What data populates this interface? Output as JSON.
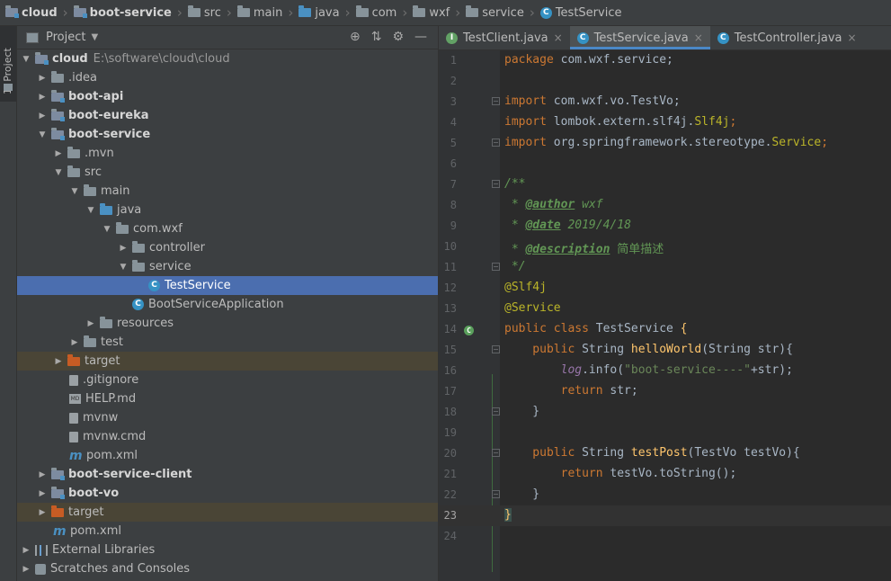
{
  "breadcrumb": [
    "cloud",
    "boot-service",
    "src",
    "main",
    "java",
    "com",
    "wxf",
    "service",
    "TestService"
  ],
  "sidebar_tab": "1: Project",
  "project": {
    "title": "Project",
    "root_name": "cloud",
    "root_path": "E:\\software\\cloud\\cloud",
    "items": [
      {
        "label": ".idea"
      },
      {
        "label": "boot-api"
      },
      {
        "label": "boot-eureka"
      },
      {
        "label": "boot-service"
      },
      {
        "label": ".mvn"
      },
      {
        "label": "src"
      },
      {
        "label": "main"
      },
      {
        "label": "java"
      },
      {
        "label": "com.wxf"
      },
      {
        "label": "controller"
      },
      {
        "label": "service"
      },
      {
        "label": "TestService"
      },
      {
        "label": "BootServiceApplication"
      },
      {
        "label": "resources"
      },
      {
        "label": "test"
      },
      {
        "label": "target"
      },
      {
        "label": ".gitignore"
      },
      {
        "label": "HELP.md"
      },
      {
        "label": "mvnw"
      },
      {
        "label": "mvnw.cmd"
      },
      {
        "label": "pom.xml"
      },
      {
        "label": "boot-service-client"
      },
      {
        "label": "boot-vo"
      },
      {
        "label": "target"
      },
      {
        "label": "pom.xml"
      },
      {
        "label": "External Libraries"
      },
      {
        "label": "Scratches and Consoles"
      }
    ]
  },
  "editor": {
    "tabs": [
      {
        "label": "TestClient.java",
        "close": "×"
      },
      {
        "label": "TestService.java",
        "close": "×"
      },
      {
        "label": "TestController.java",
        "close": "×"
      }
    ],
    "line_numbers": [
      "1",
      "2",
      "3",
      "4",
      "5",
      "6",
      "7",
      "8",
      "9",
      "10",
      "11",
      "12",
      "13",
      "14",
      "15",
      "16",
      "17",
      "18",
      "19",
      "20",
      "21",
      "22",
      "23",
      "24"
    ],
    "code": {
      "l1_kw": "package",
      "l1_rest": " com.wxf.service;",
      "l3_kw": "import",
      "l3_rest": " com.wxf.vo.TestVo;",
      "l4_kw": "import",
      "l4_rest": " lombok.extern.slf4j.",
      "l4_ann": "Slf4j",
      "l4_end": ";",
      "l5_kw": "import",
      "l5_rest": " org.springframework.stereotype.",
      "l5_ann": "Service",
      "l5_end": ";",
      "l7": "/**",
      "l8_pre": " * ",
      "l8_tag": "@author",
      "l8_val": " wxf",
      "l9_pre": " * ",
      "l9_tag": "@date",
      "l9_val": " 2019/4/18",
      "l10_pre": " * ",
      "l10_tag": "@description",
      "l10_val": " 简单描述",
      "l11": " */",
      "l12": "@Slf4j",
      "l13": "@Service",
      "l14_kw": "public class",
      "l14_name": " TestService ",
      "l14_brace": "{",
      "l15_kw": "    public",
      "l15_type": " String ",
      "l15_fn": "helloWorld",
      "l15_rest": "(String str){",
      "l16_fld": "        log",
      "l16_a": ".info(",
      "l16_str": "\"boot-service----\"",
      "l16_b": "+str);",
      "l17_kw": "        return",
      "l17_rest": " str;",
      "l18": "    }",
      "l20_kw": "    public",
      "l20_type": " String ",
      "l20_fn": "testPost",
      "l20_rest": "(TestVo testVo){",
      "l21_kw": "        return",
      "l21_rest": " testVo.toString();",
      "l22": "    }",
      "l23": "}"
    }
  }
}
